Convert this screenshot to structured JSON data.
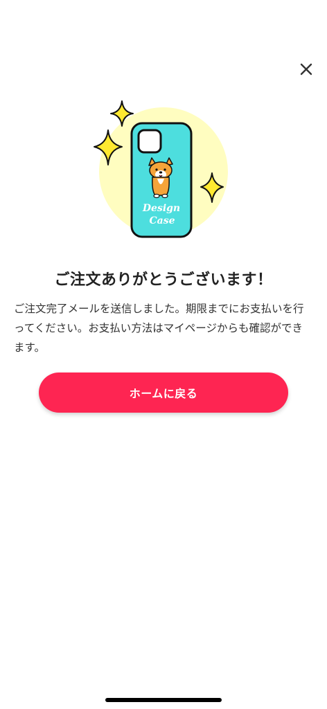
{
  "icons": {
    "close": "close-icon",
    "illustration": "phone-case-illustration"
  },
  "illustration": {
    "case_text_line1": "Design",
    "case_text_line2": "Case"
  },
  "colors": {
    "accent": "#fe2552",
    "case": "#4ddede",
    "halo": "#fffdc0",
    "sparkle": "#ffe930"
  },
  "title": "ご注文ありがとうございます！",
  "message": "ご注文完了メールを送信しました。期限までにお支払いを行ってください。お支払い方法はマイページからも確認ができます。",
  "home_button_label": "ホームに戻る"
}
